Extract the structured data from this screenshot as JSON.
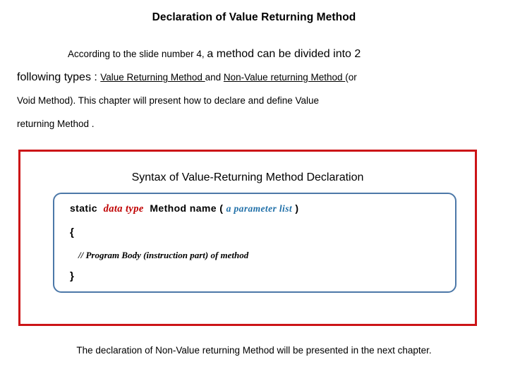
{
  "slide": {
    "title": "Declaration of Value Returning Method",
    "paragraph": {
      "line1_part1": "According to the slide number 4, ",
      "line1_part2": "a method can be divided into 2",
      "line2_part1": "following types : ",
      "line2_underline1": "Value Returning Method ",
      "line2_part2": "and ",
      "line2_underline2": "Non-Value returning Method ",
      "line2_part3": "(or",
      "line3": "Void Method). This chapter will present how to declare and define Value",
      "line4": "returning Method ."
    },
    "syntax_box": {
      "heading": "Syntax of  Value-Returning Method Declaration",
      "signature": {
        "static_keyword": "static",
        "data_type": "data type",
        "method_name": "Method name (",
        "parameter_list": "a parameter list",
        "close_paren": ")"
      },
      "brace_open": "{",
      "comment": "// Program Body (instruction part) of method",
      "brace_close": "}"
    },
    "footer": "The declaration of Non-Value returning Method will be presented in the next chapter.",
    "colors": {
      "outer_box_border": "#CC1417",
      "inner_box_border": "#4C78A8",
      "data_type_text": "#C00000",
      "parameter_list_text": "#1F6FA8",
      "body_text": "#000000",
      "background": "#FFFFFF"
    }
  }
}
